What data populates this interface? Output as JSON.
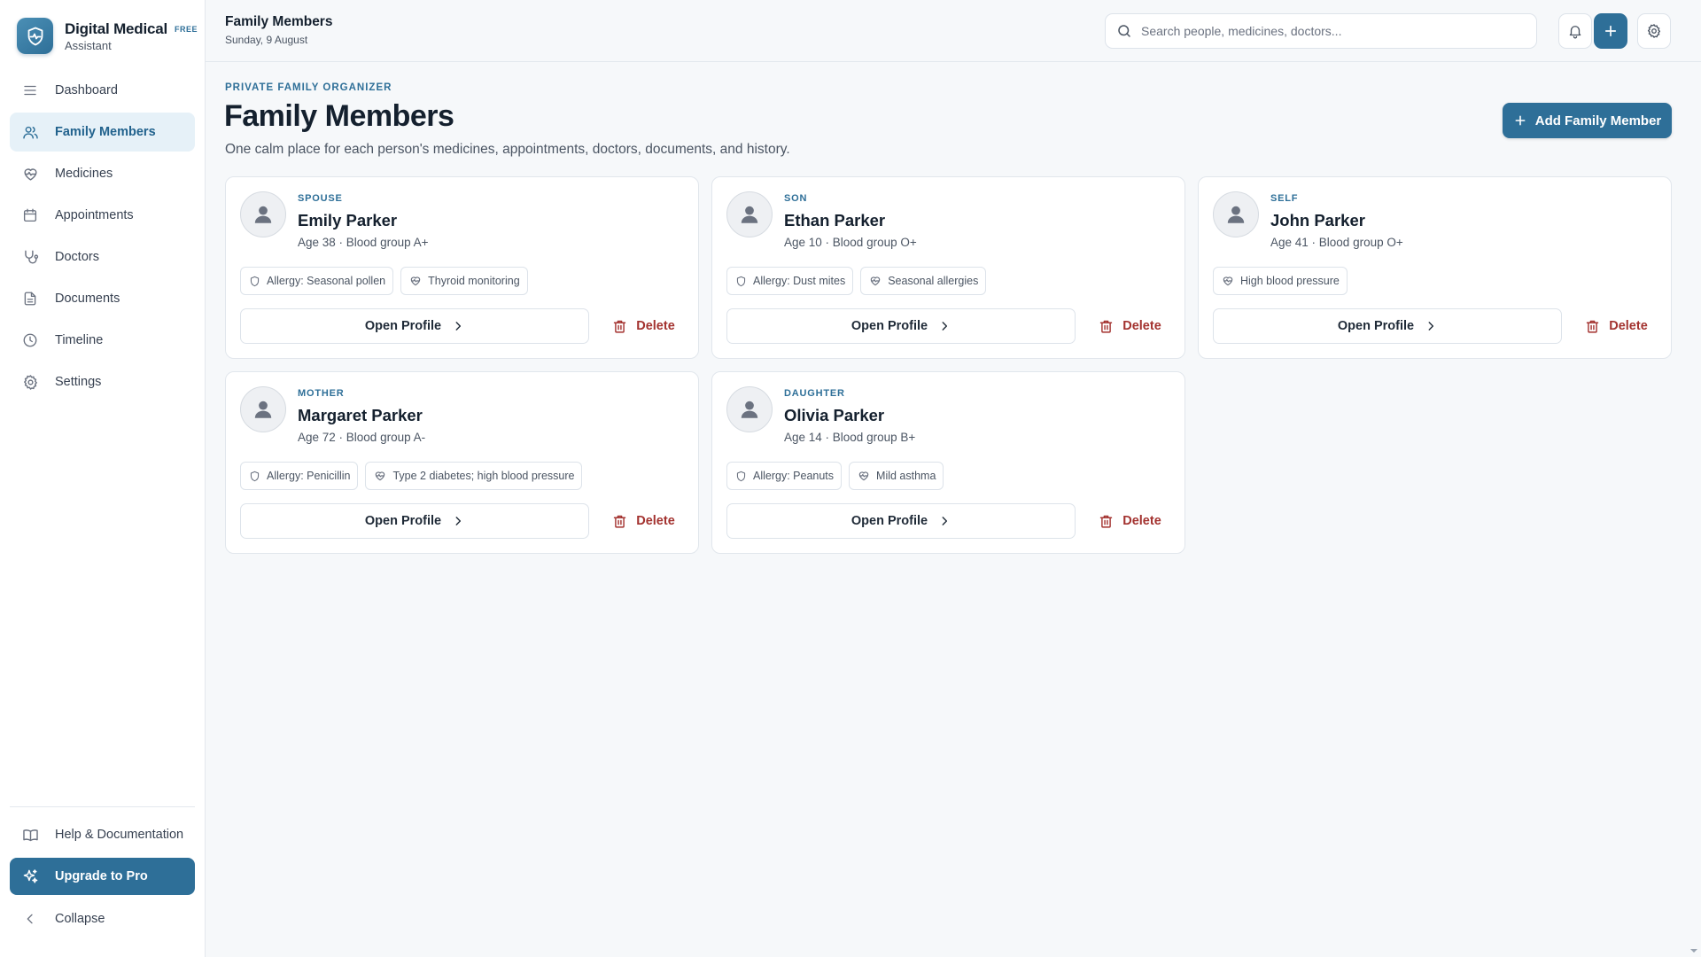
{
  "brand": {
    "name": "Digital Medical",
    "badge": "FREE",
    "subtitle": "Assistant"
  },
  "sidebar": {
    "items": [
      {
        "label": "Dashboard",
        "icon": "menu-icon"
      },
      {
        "label": "Family Members",
        "icon": "users-icon",
        "active": true
      },
      {
        "label": "Medicines",
        "icon": "heart-pulse-icon"
      },
      {
        "label": "Appointments",
        "icon": "calendar-icon"
      },
      {
        "label": "Doctors",
        "icon": "stethoscope-icon"
      },
      {
        "label": "Documents",
        "icon": "document-icon"
      },
      {
        "label": "Timeline",
        "icon": "clock-icon"
      },
      {
        "label": "Settings",
        "icon": "gear-icon"
      }
    ],
    "help_label": "Help & Documentation",
    "upgrade_label": "Upgrade to Pro",
    "collapse_label": "Collapse"
  },
  "header": {
    "title": "Family Members",
    "date": "Sunday, 9 August",
    "search_placeholder": "Search people, medicines, doctors..."
  },
  "main": {
    "eyebrow": "PRIVATE FAMILY ORGANIZER",
    "title": "Family Members",
    "subtitle": "One calm place for each person's medicines, appointments, doctors, documents, and history.",
    "add_label": "Add Family Member",
    "open_label": "Open Profile",
    "delete_label": "Delete"
  },
  "members": [
    {
      "relation": "SPOUSE",
      "name": "Emily Parker",
      "meta": "Age 38 · Blood group A+",
      "tags": [
        {
          "icon": "shield-icon",
          "text": "Allergy: Seasonal pollen"
        },
        {
          "icon": "heart-pulse-icon",
          "text": "Thyroid monitoring"
        }
      ]
    },
    {
      "relation": "SON",
      "name": "Ethan Parker",
      "meta": "Age 10 · Blood group O+",
      "tags": [
        {
          "icon": "shield-icon",
          "text": "Allergy: Dust mites"
        },
        {
          "icon": "heart-pulse-icon",
          "text": "Seasonal allergies"
        }
      ]
    },
    {
      "relation": "SELF",
      "name": "John Parker",
      "meta": "Age 41 · Blood group O+",
      "tags": [
        {
          "icon": "heart-pulse-icon",
          "text": "High blood pressure"
        }
      ]
    },
    {
      "relation": "MOTHER",
      "name": "Margaret Parker",
      "meta": "Age 72 · Blood group A-",
      "tags": [
        {
          "icon": "shield-icon",
          "text": "Allergy: Penicillin"
        },
        {
          "icon": "heart-pulse-icon",
          "text": "Type 2 diabetes; high blood pressure"
        }
      ]
    },
    {
      "relation": "DAUGHTER",
      "name": "Olivia Parker",
      "meta": "Age 14 · Blood group B+",
      "tags": [
        {
          "icon": "shield-icon",
          "text": "Allergy: Peanuts"
        },
        {
          "icon": "heart-pulse-icon",
          "text": "Mild asthma"
        }
      ]
    }
  ],
  "colors": {
    "accent": "#2e6f98",
    "danger": "#a3322f",
    "active_bg": "#e6f1f8"
  }
}
